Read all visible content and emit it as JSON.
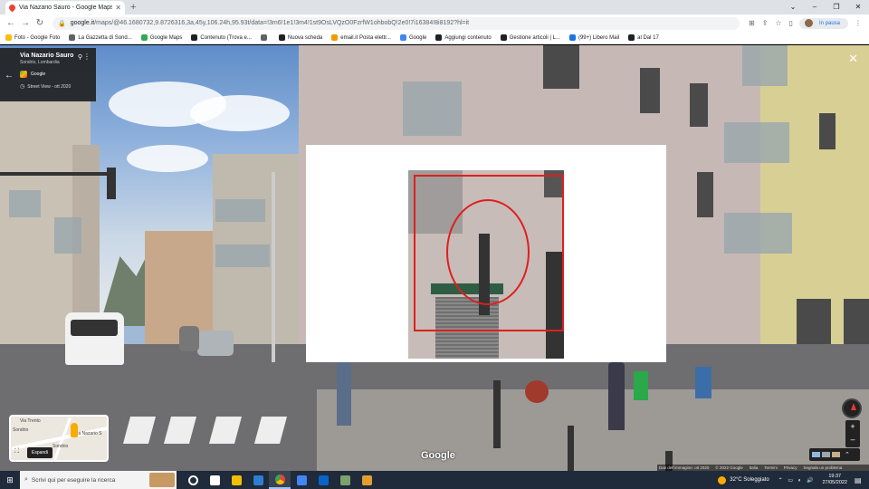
{
  "browser": {
    "tab_title": "Via Nazario Sauro - Google Maps",
    "new_tab": "+",
    "url_host": "google.it",
    "url_path": "/maps/@46.1680732,9.8726316,3a,45y,106.24h,95.93t/data=!3m6!1e1!3m4!1st9OsLVQzO0FzrfW1ohbobQ!2e0!7i16384!8i8192?hl=it",
    "profile_status": "In pausa",
    "window_controls": [
      "⌄",
      "–",
      "❐",
      "✕"
    ]
  },
  "bookmarks": [
    {
      "label": "Foto - Google Foto",
      "color": "#fbbc04"
    },
    {
      "label": "La Gazzetta di Sond...",
      "color": "#5f6368"
    },
    {
      "label": "Google Maps",
      "color": "#34a853"
    },
    {
      "label": "Contenuto (Trova e...",
      "color": "#202124"
    },
    {
      "label": "",
      "color": "#5f6368"
    },
    {
      "label": "Nuova scheda",
      "color": "#202124"
    },
    {
      "label": "email.it Posta elettr...",
      "color": "#f29900"
    },
    {
      "label": "Google",
      "color": "#4285f4"
    },
    {
      "label": "Aggiungi contenuto",
      "color": "#202124"
    },
    {
      "label": "Gestione articoli | L...",
      "color": "#202124"
    },
    {
      "label": "(99+) Libero Mail",
      "color": "#1a73e8"
    },
    {
      "label": "al Dal 17",
      "color": "#202124"
    }
  ],
  "infocard": {
    "title": "Via Nazario Sauro",
    "subtitle": "Sondrio, Lombardia",
    "provider": "Google",
    "date": "Street View - ott 2020"
  },
  "minimap": {
    "labels": [
      "Sondrio",
      "Via Nazario S",
      "Via Trento",
      "Sondrio"
    ],
    "expand_label": "Espandi"
  },
  "watermark": "Google",
  "zoom": {
    "plus": "+",
    "minus": "–"
  },
  "attribution": [
    "Dati dell'immagine: ott 2020",
    "© 2022 Google",
    "Italia",
    "Termini",
    "Privacy",
    "Segnala un problema"
  ],
  "taskbar": {
    "search_placeholder": "Scrivi qui per eseguire la ricerca",
    "weather": "32°C Soleggiato",
    "time": "19:37",
    "date": "27/05/2022",
    "apps": [
      {
        "name": "cortana",
        "color": "#ffffff"
      },
      {
        "name": "task-view",
        "color": "#ffffff"
      },
      {
        "name": "file-explorer",
        "color": "#f0c000"
      },
      {
        "name": "store",
        "color": "#2f7dd1"
      },
      {
        "name": "chrome",
        "color": "#e94235"
      },
      {
        "name": "docs",
        "color": "#4285f4"
      },
      {
        "name": "mail",
        "color": "#0a64c8"
      },
      {
        "name": "app",
        "color": "#7aa36c"
      },
      {
        "name": "media",
        "color": "#e0a030"
      }
    ]
  }
}
